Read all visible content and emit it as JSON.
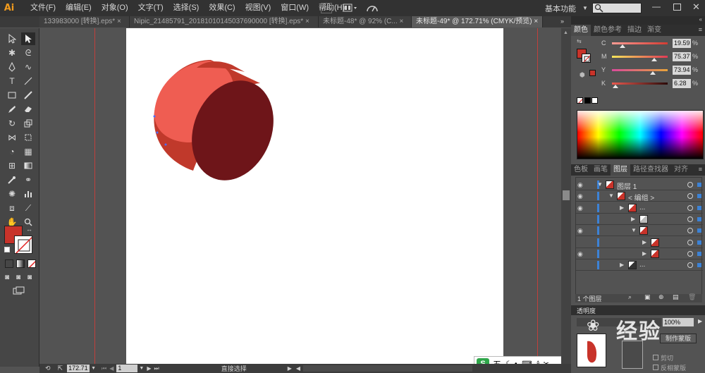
{
  "app": {
    "logo": "Ai"
  },
  "menus": [
    "文件(F)",
    "编辑(E)",
    "对象(O)",
    "文字(T)",
    "选择(S)",
    "效果(C)",
    "视图(V)",
    "窗口(W)",
    "帮助(H)"
  ],
  "header": {
    "br_label": "Br",
    "workspace": "基本功能"
  },
  "tabs": [
    {
      "label": "133983000 [转换].eps*",
      "active": false
    },
    {
      "label": "Nipic_21485791_20181010145037690000 [转换].eps*",
      "active": false
    },
    {
      "label": "未标题-48* @ 92% (C...",
      "active": false
    },
    {
      "label": "未标题-49* @ 172.71% (CMYK/预览)",
      "active": true
    }
  ],
  "tab_close": "×",
  "color_panel": {
    "tabs": [
      "颜色",
      "颜色参考",
      "描边",
      "渐变"
    ],
    "channels": [
      {
        "label": "C",
        "value": "19.59",
        "fraction": 0.196,
        "gradient": "#ff9b93,#d33c33"
      },
      {
        "label": "M",
        "value": "75.37",
        "fraction": 0.754,
        "gradient": "#f4e55a,#e23a56"
      },
      {
        "label": "Y",
        "value": "73.94",
        "fraction": 0.739,
        "gradient": "#d94a9a,#e7a33a"
      },
      {
        "label": "K",
        "value": "6.28",
        "fraction": 0.063,
        "gradient": "#e9594f,#2b0a08"
      }
    ],
    "percent": "%",
    "fill_color": "#c8332a"
  },
  "layers_panel": {
    "tabs": [
      "色板",
      "画笔",
      "图层",
      "路径查找器",
      "对齐"
    ],
    "rows": [
      {
        "name": "图层 1",
        "indent": 0,
        "eye": true,
        "thumb": "#c8332a"
      },
      {
        "name": "< 编组 >",
        "indent": 1,
        "eye": true,
        "thumb": "#c8332a"
      },
      {
        "name": "...",
        "indent": 2,
        "eye": true,
        "thumb": "#c8332a"
      },
      {
        "name": "",
        "indent": 3,
        "eye": false,
        "thumb": "#bbbbbb"
      },
      {
        "name": "",
        "indent": 3,
        "eye": true,
        "thumb": "#c8332a"
      },
      {
        "name": "",
        "indent": 4,
        "eye": false,
        "thumb": "#c8332a"
      },
      {
        "name": "",
        "indent": 4,
        "eye": true,
        "thumb": "#c8332a"
      },
      {
        "name": "...",
        "indent": 2,
        "eye": false,
        "thumb": "#333333"
      }
    ],
    "footer": "1 个图层"
  },
  "transparency_panel": {
    "title": "透明度",
    "opacity": "100%",
    "make_mask": "制作蒙版",
    "clip": "剪切",
    "invert_mask": "反相蒙版"
  },
  "status": {
    "zoom": "172.71",
    "page": "1",
    "tool": "直接选择"
  },
  "ime": {
    "label": "五"
  },
  "watermark": "经验",
  "colors": {
    "fill": "#c8332a",
    "shape_light": "#ef5d52",
    "shape_dark": "#6e1519",
    "shape_mid": "#c0392b"
  }
}
